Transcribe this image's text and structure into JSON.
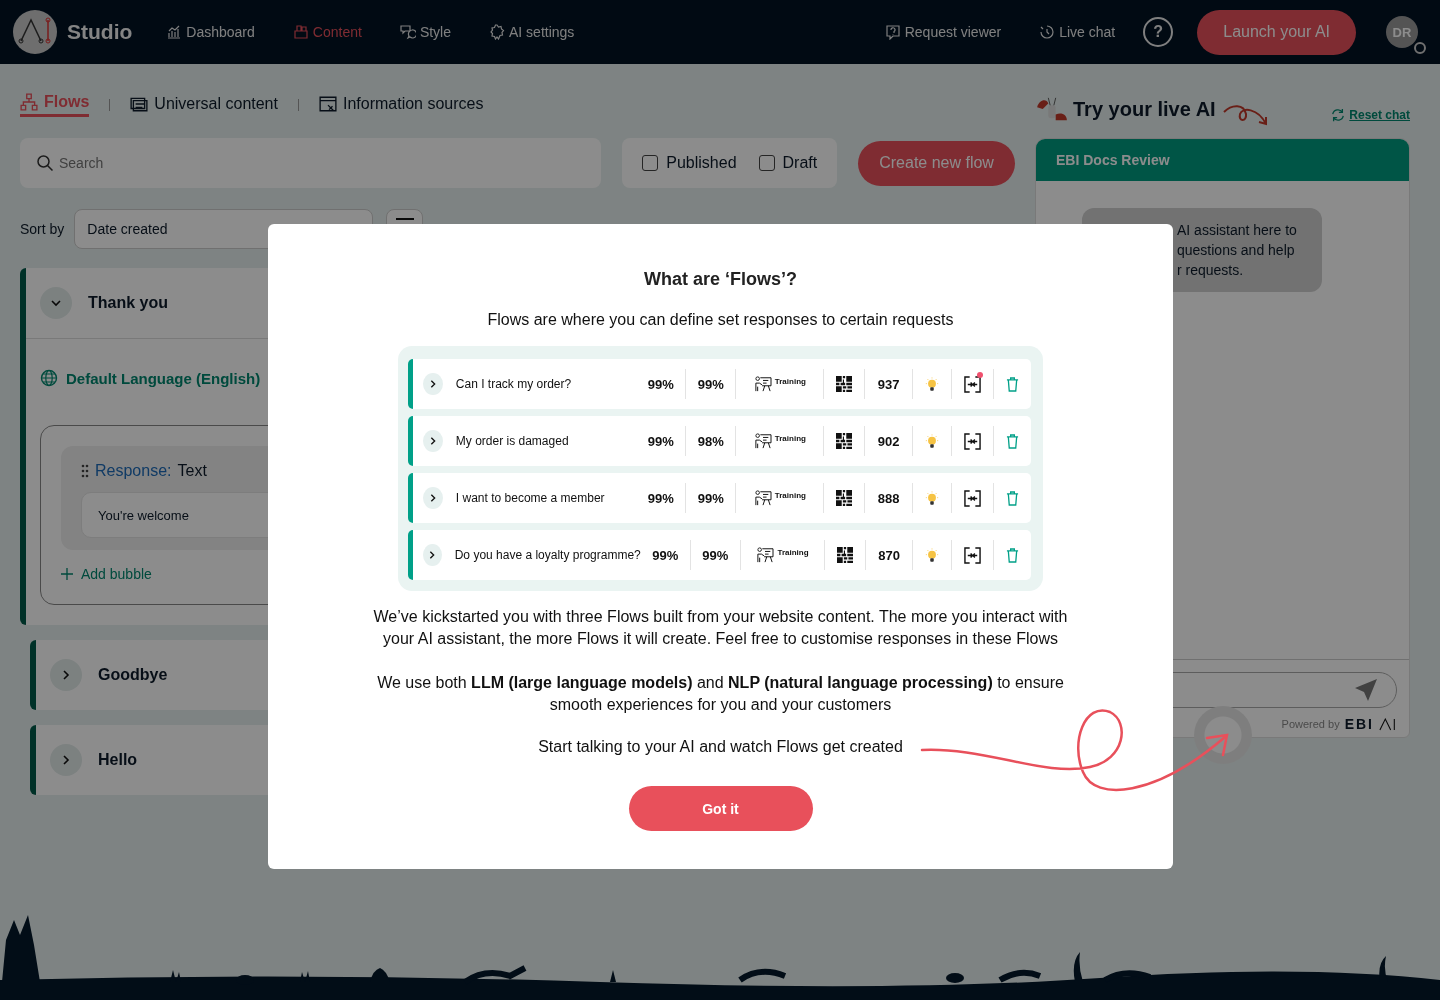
{
  "nav": {
    "brand": "Studio",
    "items": [
      {
        "label": "Dashboard",
        "selected": false
      },
      {
        "label": "Content",
        "selected": true
      },
      {
        "label": "Style",
        "selected": false
      },
      {
        "label": "AI settings",
        "selected": false
      }
    ],
    "right_items": [
      {
        "label": "Request viewer"
      },
      {
        "label": "Live chat"
      }
    ],
    "help": "?",
    "launch_button": "Launch your AI",
    "avatar": "DR"
  },
  "tabs": [
    {
      "label": "Flows",
      "selected": true
    },
    {
      "label": "Universal content",
      "selected": false
    },
    {
      "label": "Information sources",
      "selected": false
    }
  ],
  "search": {
    "placeholder": "Search"
  },
  "filters": [
    {
      "label": "Published",
      "checked": false
    },
    {
      "label": "Draft",
      "checked": false
    }
  ],
  "create_button": "Create new flow",
  "sort": {
    "label": "Sort by",
    "value": "Date created"
  },
  "flows": [
    {
      "title": "Thank you",
      "expanded": true,
      "language": "Default Language (English)",
      "response_label": "Response:",
      "response_type": "Text",
      "response_text": "You're welcome",
      "add_bubble": "Add bubble"
    },
    {
      "title": "Goodbye",
      "expanded": false
    },
    {
      "title": "Hello",
      "expanded": false
    }
  ],
  "chat": {
    "heading": "Try your live AI",
    "reset": "Reset chat",
    "title": "EBI Docs Review",
    "message_lines": [
      "AI assistant here to",
      "questions and help",
      "r requests."
    ],
    "powered_by": "Powered by",
    "brand": "EBI"
  },
  "modal": {
    "title": "What are ‘Flows’?",
    "subtitle": "Flows are where you can define set responses to certain requests",
    "rows": [
      {
        "question": "Can I track my order?",
        "score_1": "99%",
        "score_2": "99%",
        "training": "Training",
        "count": "937",
        "alert": true
      },
      {
        "question": "My order is damaged",
        "score_1": "99%",
        "score_2": "98%",
        "training": "Training",
        "count": "902",
        "alert": false
      },
      {
        "question": "I want to become a member",
        "score_1": "99%",
        "score_2": "99%",
        "training": "Training",
        "count": "888",
        "alert": false
      },
      {
        "question": "Do you have a loyalty programme?",
        "score_1": "99%",
        "score_2": "99%",
        "training": "Training",
        "count": "870",
        "alert": false
      }
    ],
    "paragraphs": [
      "We’ve kickstarted you with three Flows built from your website content. The more you interact with your AI assistant, the more Flows it will create. Feel free to customise responses in these Flows",
      "We use both **LLM (large language models)** and **NLP (natural language processing)** to ensure smooth experiences for you and your customers"
    ],
    "cta": "Start talking to your AI and watch Flows get created",
    "button": "Got it"
  }
}
